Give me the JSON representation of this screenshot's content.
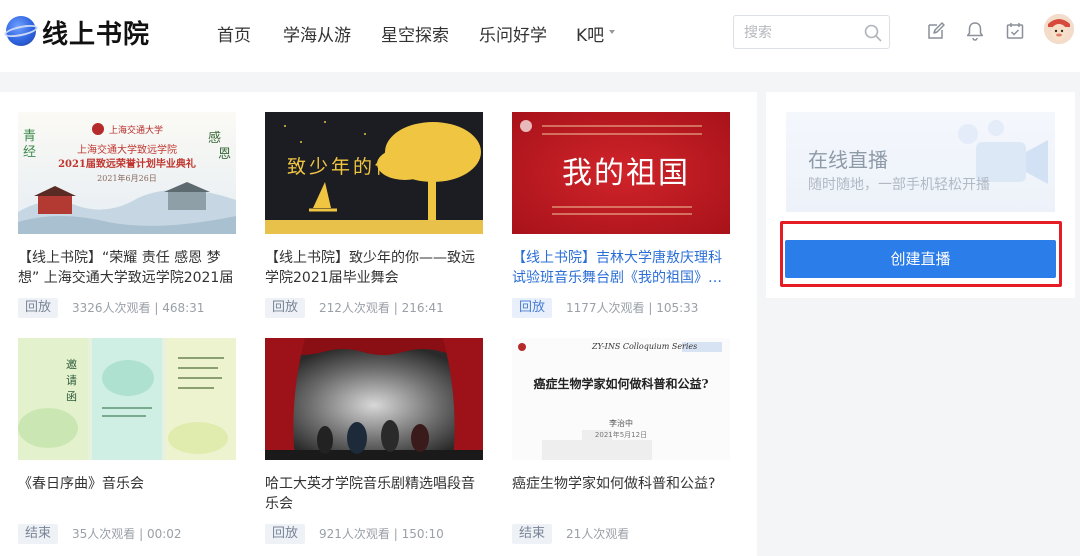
{
  "header": {
    "site_title": "线上书院",
    "nav": [
      "首页",
      "学海从游",
      "星空探索",
      "乐问好学",
      "K吧"
    ],
    "search_placeholder": "搜索",
    "icons": [
      "edit-icon",
      "bell-icon",
      "calendar-check-icon"
    ]
  },
  "thumbs": {
    "t1": {
      "top_left": "青\n经",
      "top_right": "感\n恩",
      "line1": "上海交通大学致远学院",
      "line2": "2021届致远荣誉计划毕业典礼",
      "date": "2021年6月26日"
    },
    "t2": {
      "text": "致少年的你"
    },
    "t3": {
      "text": "我的祖国"
    },
    "t6": {
      "series": "ZY-INS Colloquium Series",
      "title": "癌症生物学家如何做科普和公益?",
      "speaker": "李治中",
      "date": "2021年5月12日"
    }
  },
  "videos": [
    {
      "title": "【线上书院】“荣耀 责任 感恩 梦想” 上海交通大学致远学院2021届致…",
      "status": "回放",
      "meta": "3326人次观看 | 468:31"
    },
    {
      "title": "【线上书院】致少年的你——致远学院2021届毕业舞会",
      "status": "回放",
      "meta": "212人次观看 | 216:41"
    },
    {
      "title": "【线上书院】吉林大学唐敖庆理科试验班音乐舞台剧《我的祖国》…",
      "status": "回放",
      "meta": "1177人次观看 | 105:33"
    },
    {
      "title": "《春日序曲》音乐会",
      "status": "结束",
      "meta": "35人次观看 | 00:02"
    },
    {
      "title": "哈工大英才学院音乐剧精选唱段音乐会",
      "status": "回放",
      "meta": "921人次观看 | 150:10"
    },
    {
      "title": "癌症生物学家如何做科普和公益?",
      "status": "结束",
      "meta": "21人次观看"
    }
  ],
  "sidebar": {
    "promo_title": "在线直播",
    "promo_subtitle": "随时随地，一部手机轻松开播",
    "create_button": "创建直播"
  }
}
